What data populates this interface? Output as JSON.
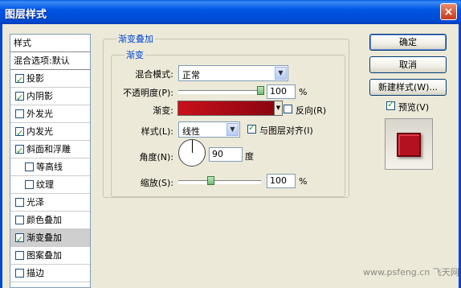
{
  "window": {
    "title": "图层样式",
    "close": "×"
  },
  "left_panel": {
    "header": "样式",
    "blend_default": "混合选项:默认",
    "items": [
      {
        "label": "投影",
        "checked": true
      },
      {
        "label": "内阴影",
        "checked": true
      },
      {
        "label": "外发光",
        "checked": false
      },
      {
        "label": "内发光",
        "checked": true
      },
      {
        "label": "斜面和浮雕",
        "checked": true
      },
      {
        "label": "等高线",
        "checked": false,
        "indent": true
      },
      {
        "label": "纹理",
        "checked": false,
        "indent": true
      },
      {
        "label": "光泽",
        "checked": false
      },
      {
        "label": "颜色叠加",
        "checked": false
      },
      {
        "label": "渐变叠加",
        "checked": true,
        "selected": true
      },
      {
        "label": "图案叠加",
        "checked": false
      },
      {
        "label": "描边",
        "checked": false
      }
    ]
  },
  "main": {
    "group_title": "渐变叠加",
    "sub_title": "渐变",
    "blend_mode_label": "混合模式:",
    "blend_mode_value": "正常",
    "opacity_label": "不透明度(P):",
    "opacity_value": "100",
    "opacity_unit": "%",
    "opacity_level": 1.0,
    "gradient_label": "渐变:",
    "reverse_label": "反向(R)",
    "reverse_checked": false,
    "style_label": "样式(L):",
    "style_value": "线性",
    "align_label": "与图层对齐(I)",
    "align_checked": true,
    "angle_label": "角度(N):",
    "angle_value": "90",
    "angle_unit": "度",
    "scale_label": "缩放(S):",
    "scale_value": "100",
    "scale_unit": "%",
    "scale_level": 0.4
  },
  "buttons": {
    "ok": "确定",
    "cancel": "取消",
    "new_style": "新建样式(W)...",
    "preview_label": "预览(V)",
    "preview_checked": true
  },
  "watermark": "www.psfeng.cn 飞天网"
}
